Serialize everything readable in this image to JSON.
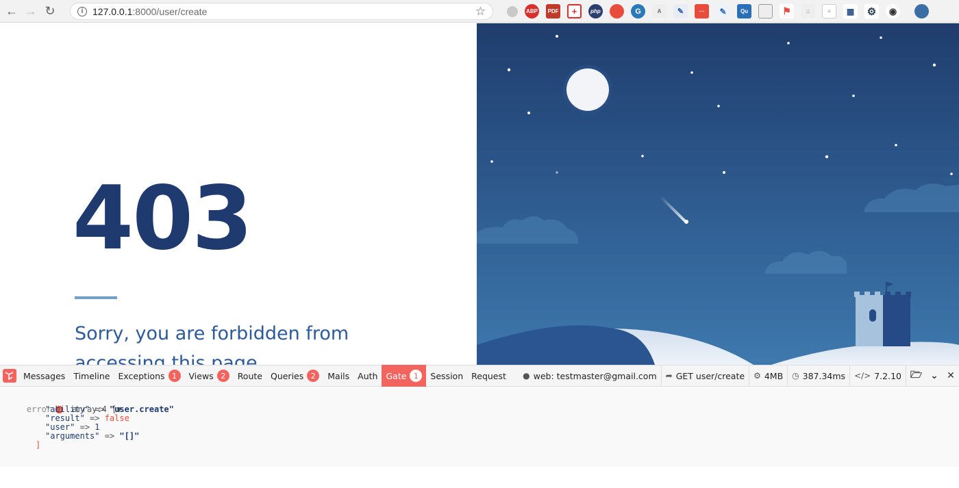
{
  "browser": {
    "url_host": "127.0.0.1",
    "url_path": ":8000/user/create",
    "extensions": [
      "shield-icon",
      "adblock-icon",
      "pdf-icon",
      "plus-icon",
      "php-icon",
      "record-icon",
      "grammarly-icon",
      "translate-icon",
      "edit-icon",
      "apps-icon",
      "colorpicker-icon",
      "qr-icon",
      "document-icon",
      "flag-icon",
      "dots-icon",
      "form-icon",
      "grid-icon",
      "gear-icon",
      "github-icon",
      "avatar-icon"
    ]
  },
  "page": {
    "code": "403",
    "message": "Sorry, you are forbidden from accessing this page."
  },
  "debugbar": {
    "tabs": [
      {
        "label": "Messages"
      },
      {
        "label": "Timeline"
      },
      {
        "label": "Exceptions",
        "badge": "1"
      },
      {
        "label": "Views",
        "badge": "2"
      },
      {
        "label": "Route"
      },
      {
        "label": "Queries",
        "badge": "2"
      },
      {
        "label": "Mails"
      },
      {
        "label": "Auth"
      },
      {
        "label": "Gate",
        "badge": "1",
        "active": true
      },
      {
        "label": "Session"
      },
      {
        "label": "Request"
      }
    ],
    "user": "web: testmaster@gmail.com",
    "route": "GET user/create",
    "memory": "4MB",
    "time": "387.34ms",
    "php_version": "7.2.10",
    "accent": "#f4645f"
  },
  "gate_panel": {
    "level": "error",
    "header": "array:4 [▼",
    "entries": [
      {
        "key": "\"ability\"",
        "arrow": "=>",
        "value": "\"user.create\""
      },
      {
        "key": "\"result\"",
        "arrow": "=>",
        "value": "false"
      },
      {
        "key": "\"user\"",
        "arrow": "=>",
        "value": "1"
      },
      {
        "key": "\"arguments\"",
        "arrow": "=>",
        "value": "\"[]\""
      }
    ],
    "close": "]"
  }
}
